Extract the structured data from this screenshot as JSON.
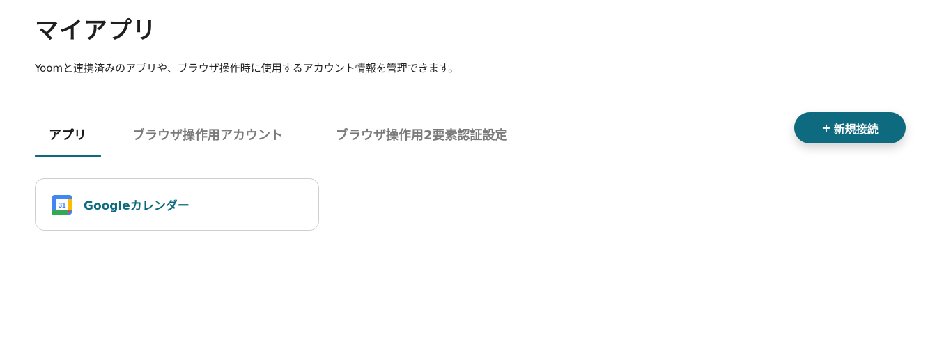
{
  "page": {
    "title": "マイアプリ",
    "description": "Yoomと連携済みのアプリや、ブラウザ操作時に使用するアカウント情報を管理できます。"
  },
  "tabs": [
    {
      "label": "アプリ",
      "active": true
    },
    {
      "label": "ブラウザ操作用アカウント",
      "active": false
    },
    {
      "label": "ブラウザ操作用2要素認証設定",
      "active": false
    }
  ],
  "new_connection": {
    "plus": "+",
    "label": "新規接続"
  },
  "apps": [
    {
      "name": "Googleカレンダー",
      "icon": "google-calendar-icon",
      "icon_text": "31"
    }
  ],
  "colors": {
    "accent": "#0e6a7f",
    "border": "#cfcfcf"
  }
}
